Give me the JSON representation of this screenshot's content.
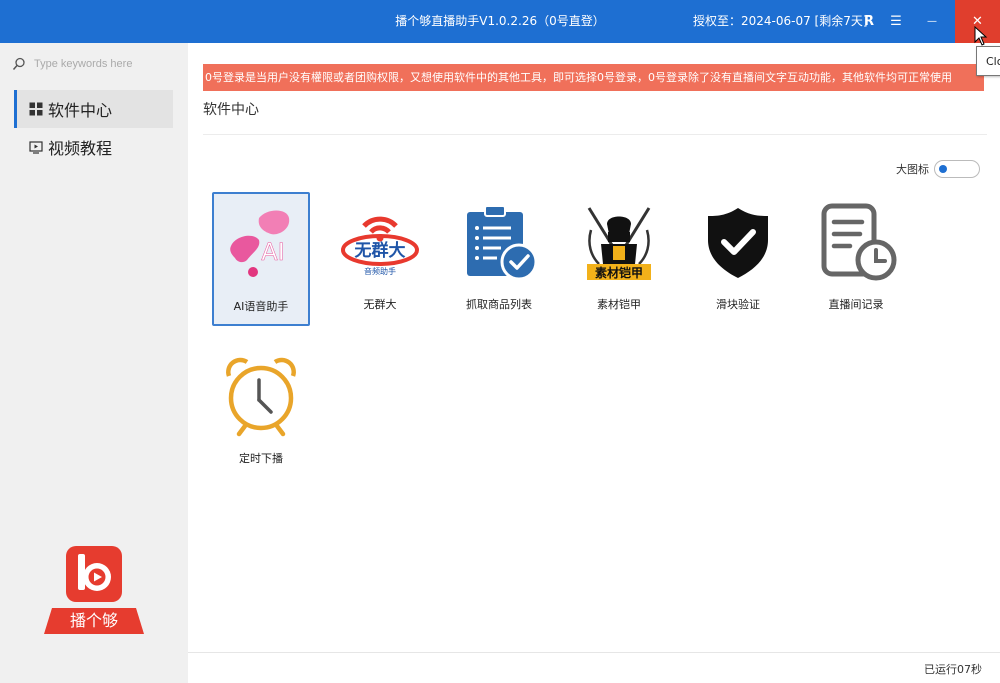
{
  "window": {
    "title": "播个够直播助手V1.0.2.26（0号直登）",
    "license": "授权至：2024-06-07 [剩余7天]",
    "r_label": "R",
    "menu_glyph": "☰",
    "min_glyph": "—",
    "close_glyph": "✕",
    "close_tooltip": "Clo"
  },
  "sidebar": {
    "search_placeholder": "Type keywords here",
    "items": [
      {
        "label": "软件中心",
        "icon": "grid-icon",
        "active": true
      },
      {
        "label": "视频教程",
        "icon": "video-icon",
        "active": false
      }
    ],
    "brand_name": "播个够"
  },
  "main": {
    "notice": "0号登录是当用户没有權限或者团购权限，又想使用软件中的其他工具，即可选择0号登录，0号登录除了没有直播间文字互动功能，其他软件均可正常使用",
    "section_title": "软件中心",
    "toggle_label": "大图标",
    "toggle_on": false,
    "tiles": [
      {
        "label": "AI语音助手",
        "icon": "ai-voice-icon",
        "selected": true,
        "icon_text": "AI"
      },
      {
        "label": "无群大",
        "icon": "wuqunda-icon",
        "selected": false,
        "icon_text": "无群大",
        "icon_subtext": "音频助手"
      },
      {
        "label": "抓取商品列表",
        "icon": "product-list-icon",
        "selected": false
      },
      {
        "label": "素材铠甲",
        "icon": "armor-icon",
        "selected": false,
        "icon_text": "素材铠甲"
      },
      {
        "label": "滑块验证",
        "icon": "shield-check-icon",
        "selected": false
      },
      {
        "label": "直播间记录",
        "icon": "record-clock-icon",
        "selected": false
      },
      {
        "label": "定时下播",
        "icon": "alarm-clock-icon",
        "selected": false
      }
    ]
  },
  "status": {
    "runtime": "已运行07秒"
  },
  "colors": {
    "titlebar": "#1e6fd2",
    "close": "#e03e2d",
    "notice": "#f0705a",
    "brand": "#e63c2f",
    "accent": "#1e6fd2"
  }
}
